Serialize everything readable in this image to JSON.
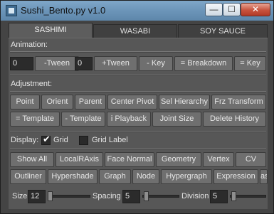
{
  "window": {
    "title": "Sushi_Bento.py v1.0",
    "min": "—",
    "max": "☐",
    "close": "✕"
  },
  "tabs": [
    {
      "label": "SASHIMI"
    },
    {
      "label": "WASABI"
    },
    {
      "label": "SOY SAUCE"
    }
  ],
  "animation": {
    "header": "Animation:",
    "field1": "0",
    "minus_tween": "-Tween",
    "field2": "0",
    "plus_tween": "+Tween",
    "minus_key": "- Key",
    "breakdown": "= Breakdown",
    "equal_key": "= Key"
  },
  "adjustment": {
    "header": "Adjustment:",
    "row1": [
      "Point",
      "Orient",
      "Parent",
      "Center Pivot",
      "Sel Hierarchy",
      "Frz Transform"
    ],
    "row2": [
      "= Template",
      "- Template",
      "i Playback",
      "Joint Size",
      "Delete History"
    ]
  },
  "display": {
    "label": "Display:",
    "grid": "Grid",
    "grid_checked": true,
    "grid_label": "Grid Label",
    "grid_label_checked": false,
    "row1": [
      "Show All",
      "LocalRAxis",
      "Face Normal",
      "Geometry",
      "Vertex",
      "CV"
    ],
    "row2": [
      "Outliner",
      "Hypershade",
      "Graph",
      "Node",
      "Hypergraph",
      "Expression",
      "as"
    ]
  },
  "sliders": {
    "size_label": "Size",
    "size_value": "12",
    "spacing_label": "Spacing",
    "spacing_value": "5",
    "division_label": "Division",
    "division_value": "5"
  }
}
